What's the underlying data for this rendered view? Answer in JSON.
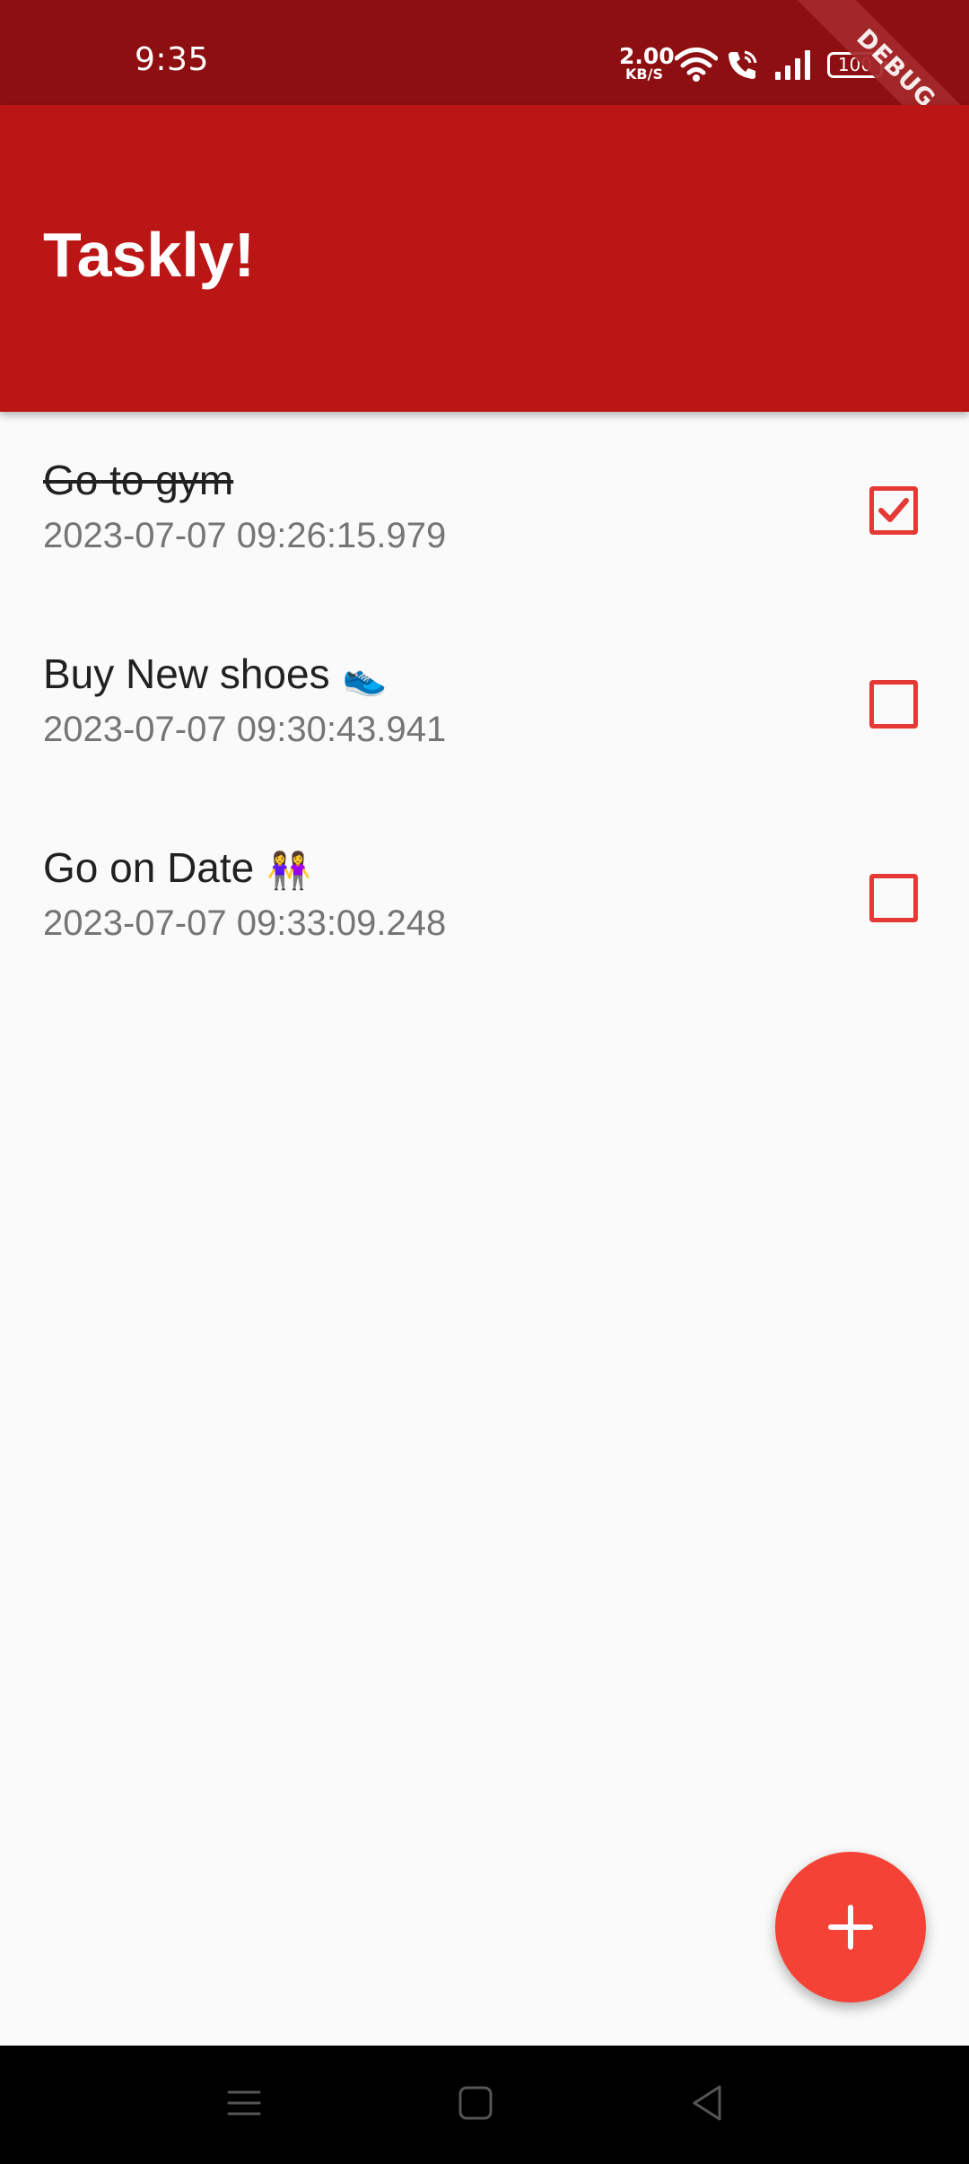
{
  "status_bar": {
    "time": "9:35",
    "net_speed_value": "2.00",
    "net_speed_unit": "KB/S",
    "battery": "100",
    "icons": [
      "wifi-icon",
      "call-icon",
      "signal-icon",
      "battery-icon"
    ]
  },
  "debug_banner": "DEBUG",
  "app_bar": {
    "title": "Taskly!"
  },
  "tasks": [
    {
      "title": "Go to gym",
      "emoji": "",
      "date": "2023-07-07 09:26:15.979",
      "done": true
    },
    {
      "title": "Buy New shoes",
      "emoji": "👟",
      "date": "2023-07-07 09:30:43.941",
      "done": false
    },
    {
      "title": "Go on Date",
      "emoji": "👭",
      "date": "2023-07-07 09:33:09.248",
      "done": false
    }
  ],
  "fab": {
    "icon": "plus-icon"
  },
  "nav_bar": {
    "icons": [
      "menu-icon",
      "home-icon",
      "back-icon"
    ]
  },
  "colors": {
    "status_bar": "#8e0f11",
    "app_bar": "#bb1616",
    "accent": "#f44336",
    "checkbox": "#e53935",
    "background": "#fafafa"
  }
}
